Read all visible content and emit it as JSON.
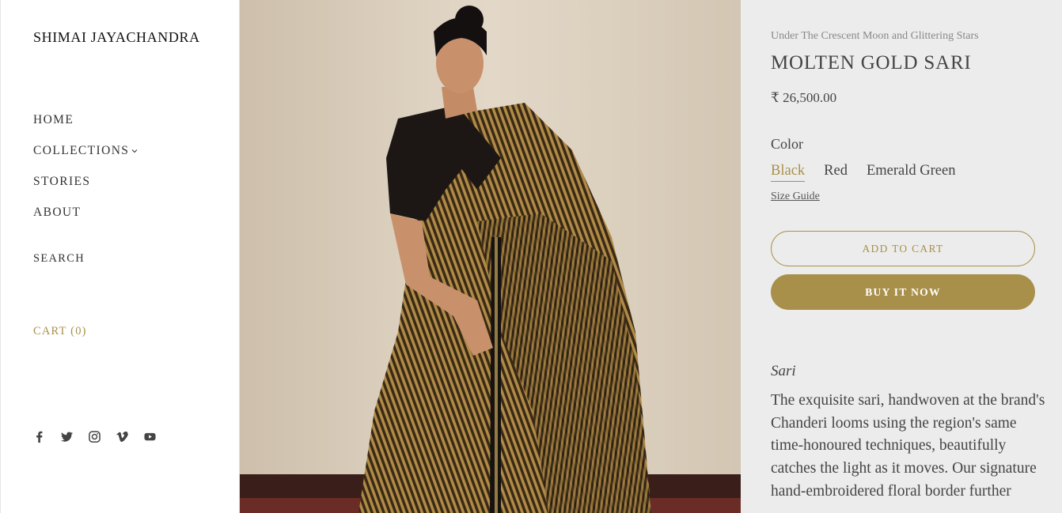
{
  "sidebar": {
    "brand": "SHIMAI JAYACHANDRA",
    "nav": [
      {
        "label": "HOME"
      },
      {
        "label": "COLLECTIONS"
      },
      {
        "label": "STORIES"
      },
      {
        "label": "ABOUT"
      }
    ],
    "search_label": "SEARCH",
    "cart_label": "CART (0)",
    "social": [
      "facebook-icon",
      "twitter-icon",
      "instagram-icon",
      "vimeo-icon",
      "youtube-icon"
    ]
  },
  "product": {
    "collection": "Under The Crescent Moon and Glittering Stars",
    "title": "MOLTEN GOLD SARI",
    "price": "₹ 26,500.00",
    "color_label": "Color",
    "colors": [
      {
        "label": "Black",
        "selected": true
      },
      {
        "label": "Red",
        "selected": false
      },
      {
        "label": "Emerald Green",
        "selected": false
      }
    ],
    "size_guide": "Size Guide",
    "add_to_cart": "ADD TO CART",
    "buy_now": "BUY IT NOW",
    "description_heading": "Sari",
    "description": "The exquisite sari, handwoven at the brand's Chanderi looms using the region's same time-honoured techniques, beautifully catches the light as it moves. Our signature hand-embroidered floral border further"
  },
  "colors": {
    "accent": "#a8904b",
    "panel_bg": "#ececec",
    "text": "#444444"
  }
}
